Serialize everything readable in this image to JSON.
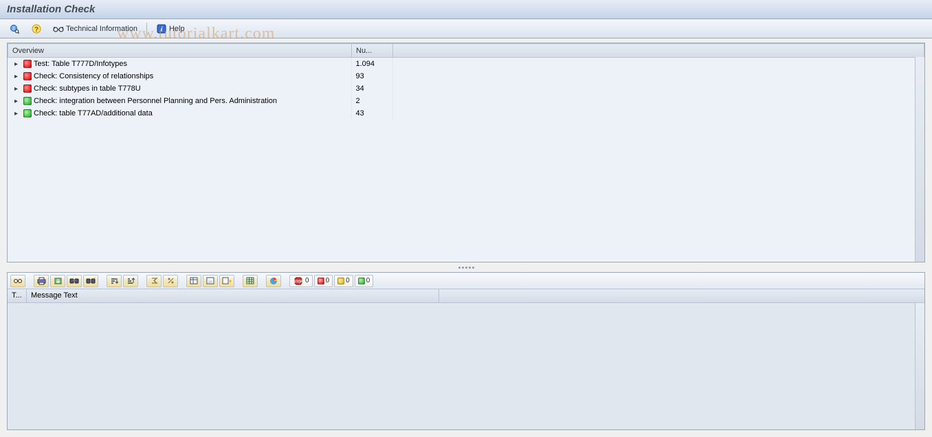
{
  "header": {
    "title": "Installation Check"
  },
  "toolbar": {
    "tech_info_label": "Technical Information",
    "help_label": "Help"
  },
  "overview": {
    "columns": {
      "c1": "Overview",
      "c2": "Nu..."
    },
    "rows": [
      {
        "status": "red",
        "label": "Test: Table T777D/Infotypes",
        "num": "1.094"
      },
      {
        "status": "red",
        "label": "Check: Consistency of relationships",
        "num": "93"
      },
      {
        "status": "red",
        "label": "Check: subtypes in table T778U",
        "num": "34"
      },
      {
        "status": "green",
        "label": "Check: integration between Personnel Planning and Pers. Administration",
        "num": "2"
      },
      {
        "status": "green",
        "label": "Check: table T77AD/additional data",
        "num": "43"
      }
    ]
  },
  "alv_counts": {
    "stop": "0",
    "red": "0",
    "yellow": "0",
    "green": "0"
  },
  "messages": {
    "col_type": "T...",
    "col_text": "Message Text"
  },
  "watermark": "www.tutorialkart.com"
}
